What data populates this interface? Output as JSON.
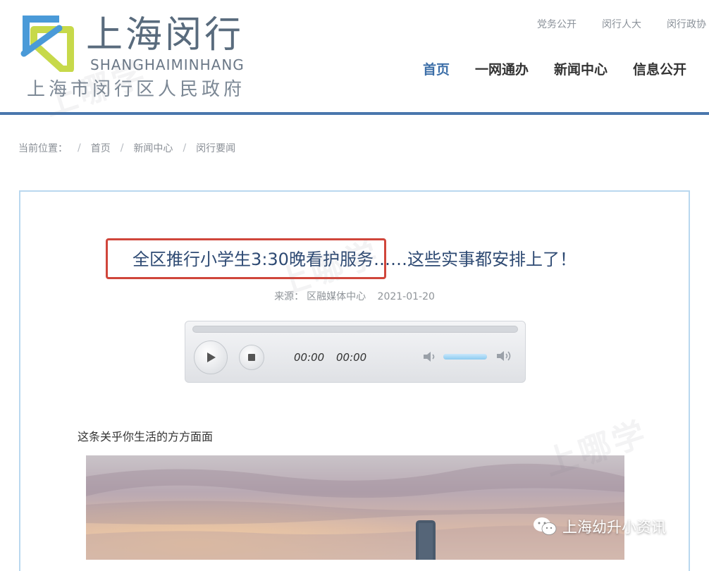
{
  "header": {
    "logo_cn": "上海闵行",
    "logo_en": "SHANGHAIMINHANG",
    "logo_sub": "上海市闵行区人民政府",
    "top_links": [
      "党务公开",
      "闵行人大",
      "闵行政协"
    ],
    "nav": [
      "首页",
      "一网通办",
      "新闻中心",
      "信息公开"
    ],
    "active_nav": "首页",
    "accent_color": "#3d6fa8",
    "logo_colors": [
      "#4a9ad8",
      "#c7d94a"
    ]
  },
  "breadcrumb": {
    "label": "当前位置：",
    "items": [
      "首页",
      "新闻中心",
      "闵行要闻"
    ]
  },
  "article": {
    "title": "全区推行小学生3:30晚看护服务……这些实事都安排上了！",
    "source_label": "来源：",
    "source": "区融媒体中心",
    "date": "2021-01-20",
    "highlight_color": "#d0463b",
    "lead": "这条关乎你生活的方方面面"
  },
  "player": {
    "current_time": "00:00",
    "duration": "00:00",
    "progress_fraction": 0,
    "volume_fraction": 1
  },
  "overlay": {
    "wechat_label": "上海幼升小资讯"
  }
}
